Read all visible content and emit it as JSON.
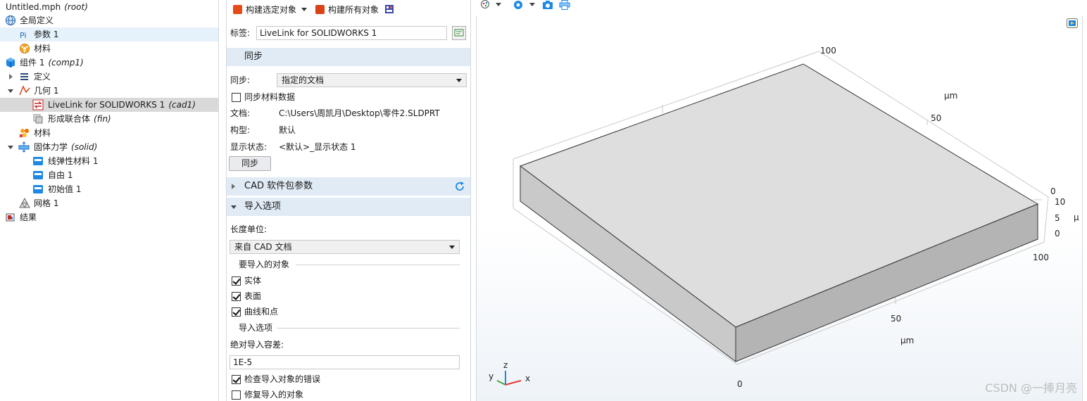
{
  "tree": {
    "root": {
      "label": "Untitled.mph",
      "tag": "(root)"
    },
    "global_definitions": "全局定义",
    "parameters": "参数 1",
    "global_materials": "材料",
    "component": {
      "label": "组件 1",
      "tag": "(comp1)"
    },
    "definitions": "定义",
    "geometry": "几何 1",
    "livelink": {
      "label": "LiveLink for SOLIDWORKS 1",
      "tag": "(cad1)"
    },
    "form_union": {
      "label": "形成联合体",
      "tag": "(fin)"
    },
    "materials": "材料",
    "solid_mechanics": {
      "label": "固体力学",
      "tag": "(solid)"
    },
    "linear_elastic": "线弹性材料 1",
    "free": "自由 1",
    "initial_values": "初始值 1",
    "mesh": "网格 1",
    "results": "结果"
  },
  "settings": {
    "toolbar": {
      "build_selected": "构建选定对象",
      "build_all": "构建所有对象"
    },
    "label_caption": "标签:",
    "label_value": "LiveLink for SOLIDWORKS 1",
    "sync_section": "同步",
    "sync_caption": "同步:",
    "sync_value": "指定的文档",
    "sync_material_data": "同步材料数据",
    "document_caption": "文档:",
    "document_value": "C:\\Users\\周凯月\\Desktop\\零件2.SLDPRT",
    "configuration_caption": "构型:",
    "configuration_value": "默认",
    "display_state_caption": "显示状态:",
    "display_state_value": "<默认>_显示状态 1",
    "sync_button": "同步",
    "cad_params_section": "CAD 软件包参数",
    "import_options_section": "导入选项",
    "length_unit_caption": "长度单位:",
    "length_unit_value": "来自 CAD 文档",
    "objects_group": "要导入的对象",
    "solids": "实体",
    "surfaces": "表面",
    "curves_points": "曲线和点",
    "import_options_group": "导入选项",
    "abs_tolerance_caption": "绝对导入容差:",
    "abs_tolerance_value": "1E-5",
    "check_errors": "检查导入对象的错误",
    "repair_objects": "修复导入的对象"
  },
  "graphics": {
    "ticks": {
      "top_100": "100",
      "top_unit": "μm",
      "top_50": "50",
      "right_0": "0",
      "right_10": "10",
      "right_5": "5",
      "right_unit": "μ",
      "right_0b": "0",
      "right_100": "100",
      "bottom_50": "50",
      "bottom_unit": "μm",
      "bottom_0": "0"
    },
    "axes": {
      "z": "z",
      "y": "y",
      "x": "x"
    },
    "watermark": "CSDN @一捧月亮"
  }
}
